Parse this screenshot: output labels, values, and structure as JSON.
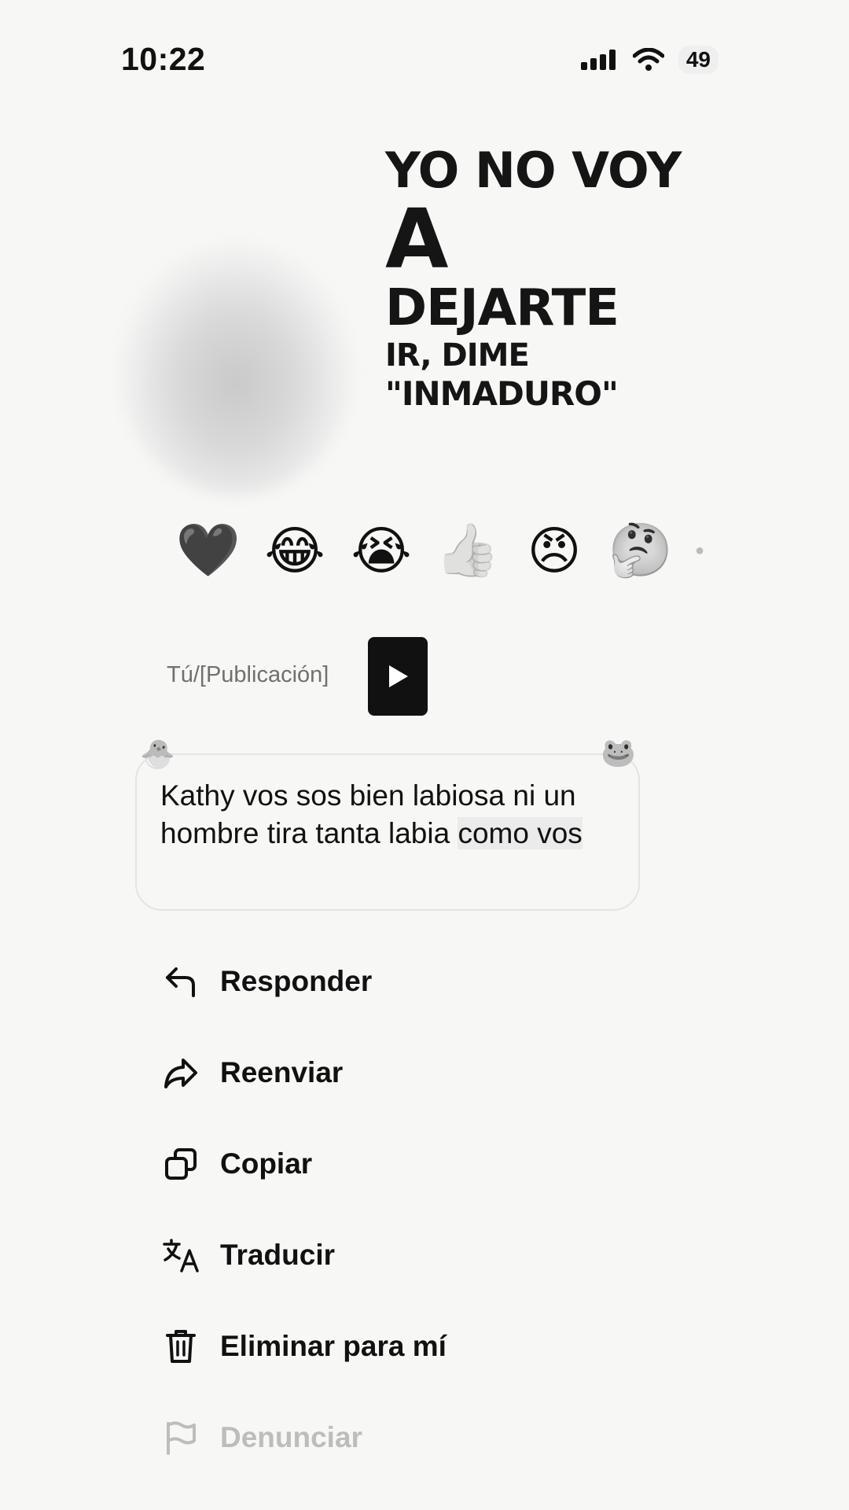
{
  "status": {
    "time": "10:22",
    "battery": "49",
    "icons": [
      "signal-icon",
      "wifi-icon"
    ]
  },
  "post": {
    "headline": [
      "YO NO VOY",
      "A",
      "DEJARTE",
      "IR, DIME",
      "\"INMADURO\""
    ]
  },
  "reactions": [
    {
      "icon": "heart-icon",
      "glyph": "🖤"
    },
    {
      "icon": "tears-of-joy-icon",
      "glyph": "😂"
    },
    {
      "icon": "crying-face-icon",
      "glyph": "😭"
    },
    {
      "icon": "thumbs-up-icon",
      "glyph": "👍"
    },
    {
      "icon": "angry-face-icon",
      "glyph": "😠"
    },
    {
      "icon": "thinking-face-icon",
      "glyph": "🤔"
    }
  ],
  "reply": {
    "label": "Tú/[Publicación]"
  },
  "message": {
    "text_main": "Kathy vos sos bien labiosa ni un hombre tira tanta labia ",
    "text_highlight": "como vos"
  },
  "menu": {
    "reply": "Responder",
    "forward": "Reenviar",
    "copy": "Copiar",
    "translate": "Traducir",
    "delete": "Eliminar para mí",
    "report": "Denunciar"
  }
}
